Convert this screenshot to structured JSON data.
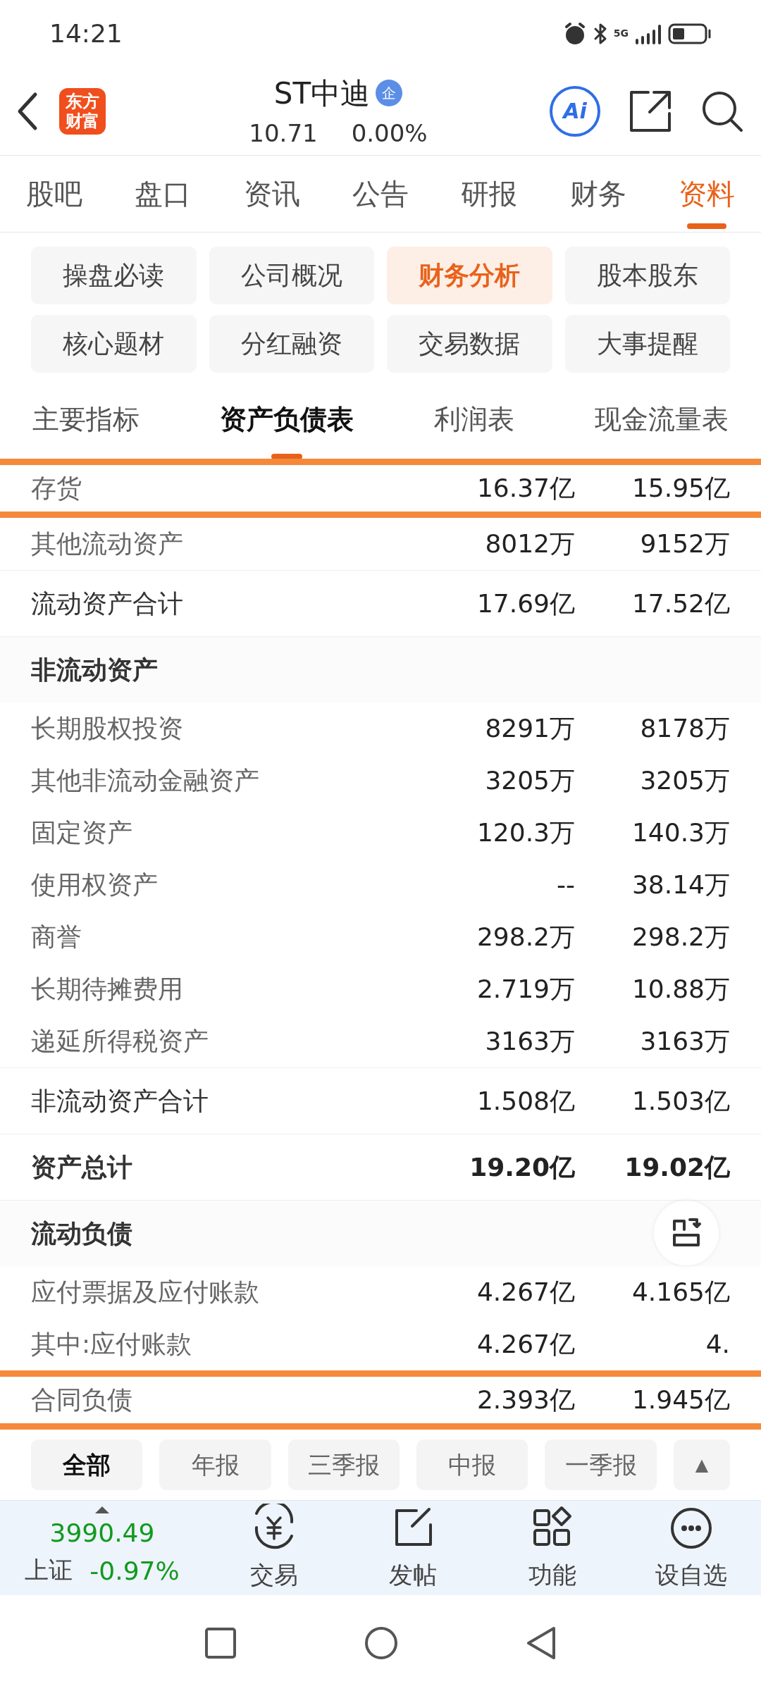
{
  "status_bar": {
    "time": "14:21",
    "network": "5G"
  },
  "header": {
    "logo_lines": [
      "东方",
      "财富"
    ],
    "title": "ST中迪",
    "badge": "企",
    "price": "10.71",
    "change": "0.00%",
    "ai_label": "Ai"
  },
  "tabs": [
    {
      "label": "股吧",
      "selected": false
    },
    {
      "label": "盘口",
      "selected": false
    },
    {
      "label": "资讯",
      "selected": false
    },
    {
      "label": "公告",
      "selected": false
    },
    {
      "label": "研报",
      "selected": false
    },
    {
      "label": "财务",
      "selected": false
    },
    {
      "label": "资料",
      "selected": true
    }
  ],
  "sections": [
    {
      "label": "操盘必读",
      "selected": false
    },
    {
      "label": "公司概况",
      "selected": false
    },
    {
      "label": "财务分析",
      "selected": true
    },
    {
      "label": "股本股东",
      "selected": false
    },
    {
      "label": "核心题材",
      "selected": false
    },
    {
      "label": "分红融资",
      "selected": false
    },
    {
      "label": "交易数据",
      "selected": false
    },
    {
      "label": "大事提醒",
      "selected": false
    }
  ],
  "statement_tabs": [
    {
      "label": "主要指标",
      "selected": false
    },
    {
      "label": "资产负债表",
      "selected": true
    },
    {
      "label": "利润表",
      "selected": false
    },
    {
      "label": "现金流量表",
      "selected": false
    }
  ],
  "table": {
    "rows": [
      {
        "kind": "row",
        "label": "存货",
        "values": [
          "16.37亿",
          "15.95亿"
        ],
        "highlighted": true
      },
      {
        "kind": "row",
        "label": "其他流动资产",
        "values": [
          "8012万",
          "9152万"
        ],
        "highlighted": false
      },
      {
        "kind": "total",
        "label": "流动资产合计",
        "values": [
          "17.69亿",
          "17.52亿"
        ],
        "highlighted": false
      },
      {
        "kind": "section",
        "label": "非流动资产",
        "highlighted": false
      },
      {
        "kind": "row",
        "label": "长期股权投资",
        "values": [
          "8291万",
          "8178万"
        ],
        "highlighted": false
      },
      {
        "kind": "row",
        "label": "其他非流动金融资产",
        "values": [
          "3205万",
          "3205万"
        ],
        "highlighted": false
      },
      {
        "kind": "row",
        "label": "固定资产",
        "values": [
          "120.3万",
          "140.3万"
        ],
        "highlighted": false
      },
      {
        "kind": "row",
        "label": "使用权资产",
        "values": [
          "--",
          "38.14万"
        ],
        "highlighted": false
      },
      {
        "kind": "row",
        "label": "商誉",
        "values": [
          "298.2万",
          "298.2万"
        ],
        "highlighted": false
      },
      {
        "kind": "row",
        "label": "长期待摊费用",
        "values": [
          "2.719万",
          "10.88万"
        ],
        "highlighted": false
      },
      {
        "kind": "row",
        "label": "递延所得税资产",
        "values": [
          "3163万",
          "3163万"
        ],
        "highlighted": false
      },
      {
        "kind": "total",
        "label": "非流动资产合计",
        "values": [
          "1.508亿",
          "1.503亿"
        ],
        "highlighted": false
      },
      {
        "kind": "grand_total",
        "label": "资产总计",
        "values": [
          "19.20亿",
          "19.02亿"
        ],
        "highlighted": false
      },
      {
        "kind": "section",
        "label": "流动负债",
        "highlighted": false
      },
      {
        "kind": "row",
        "label": "应付票据及应付账款",
        "values": [
          "4.267亿",
          "4.165亿"
        ],
        "highlighted": false
      },
      {
        "kind": "row",
        "label": "其中:应付账款",
        "values": [
          "4.267亿",
          "4."
        ],
        "highlighted": false
      },
      {
        "kind": "row",
        "label": "合同负债",
        "values": [
          "2.393亿",
          "1.945亿"
        ],
        "highlighted": true
      }
    ]
  },
  "periods": [
    {
      "label": "全部",
      "selected": true
    },
    {
      "label": "年报",
      "selected": false
    },
    {
      "label": "三季报",
      "selected": false
    },
    {
      "label": "中报",
      "selected": false
    },
    {
      "label": "一季报",
      "selected": false
    },
    {
      "label": "▲",
      "selected": false
    }
  ],
  "bottom_nav": {
    "index_value": "3990.49",
    "index_name": "上证",
    "index_change": "-0.97%",
    "items": [
      {
        "kind": "trade",
        "label": "交易"
      },
      {
        "kind": "post",
        "label": "发帖"
      },
      {
        "kind": "functions",
        "label": "功能"
      },
      {
        "kind": "watchlist",
        "label": "设自选"
      }
    ]
  }
}
